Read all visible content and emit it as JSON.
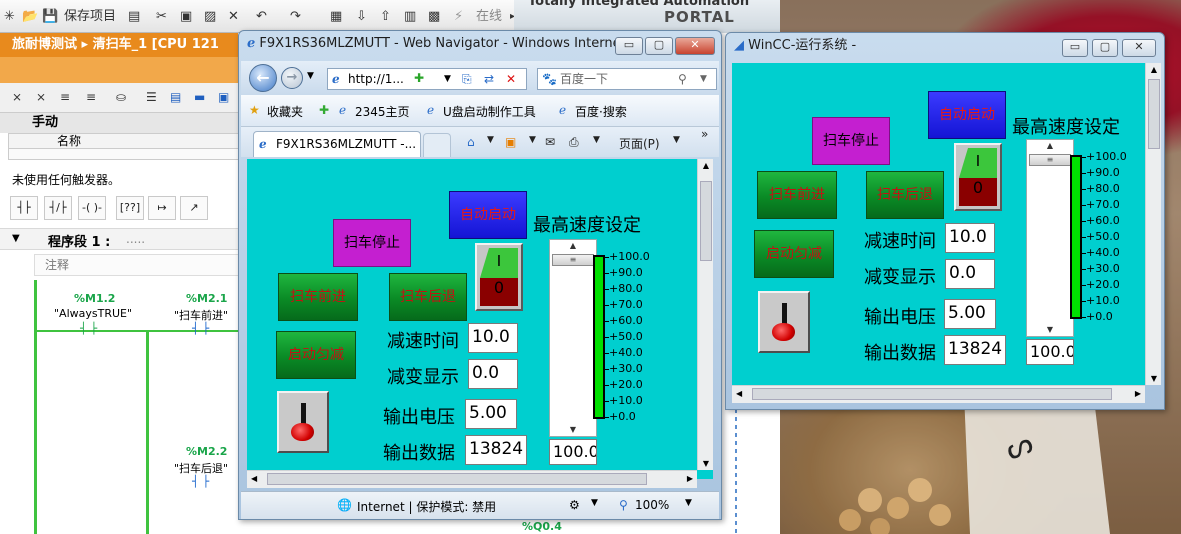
{
  "tia": {
    "toolbar": {
      "save": "保存项目",
      "online": "在线"
    },
    "brand": {
      "line1": "Totally Integrated Automation",
      "line2": "PORTAL"
    },
    "breadcrumb": "旅耐博测试 ▸ 清扫车_1 [CPU 121",
    "manual_section": "手动",
    "name_header": "名称",
    "trigger_text": "未使用任何触发器。",
    "segment": {
      "title": "程序段 1 :",
      "dots": ".....",
      "comment": "注释"
    },
    "ladder": {
      "m12_addr": "%M1.2",
      "m12_tag": "\"AlwaysTRUE\"",
      "m21_addr": "%M2.1",
      "m21_tag": "\"扫车前进\"",
      "m22_addr": "%M2.2",
      "m22_tag": "\"扫车后退\"",
      "q04_addr": "%Q0.4"
    }
  },
  "ie": {
    "title": "F9X1RS36MLZMUTT - Web Navigator - Windows Internet...",
    "address": "http://1...",
    "search_placeholder": "百度一下",
    "favorites": "收藏夹",
    "fav_links": [
      "2345主页",
      "U盘启动制作工具",
      "百度·搜索"
    ],
    "tab_title": "F9X1RS36MLZMUTT -...",
    "page_menu": "页面(P)",
    "status": "Internet | 保护模式: 禁用",
    "zoom": "100%"
  },
  "wincc": {
    "title": "WinCC-运行系统 -"
  },
  "hmi": {
    "auto_start": "自动启动",
    "max_speed_label": "最高速度设定",
    "stop": "扫车停止",
    "forward": "扫车前进",
    "backward": "扫车后退",
    "start_decel": "启动匀减",
    "toggle_on": "I",
    "toggle_off": "0",
    "decel_time_label": "减速时间",
    "decel_time_value": "10.0",
    "decel_display_label": "减变显示",
    "decel_display_value": "0.0",
    "output_voltage_label": "输出电压",
    "output_voltage_value": "5.00",
    "output_data_label": "输出数据",
    "output_data_value": "13824",
    "max_speed_value": "100.0",
    "speed_fraction": 1.0,
    "scale": [
      "+100.0",
      "+90.0",
      "+80.0",
      "+70.0",
      "+60.0",
      "+50.0",
      "+40.0",
      "+30.0",
      "+20.0",
      "+10.0",
      "+0.0"
    ]
  },
  "colors": {
    "hmi_bg": "#00cfcf",
    "green_bar": "#00e000",
    "orange": "#e88a1d"
  }
}
